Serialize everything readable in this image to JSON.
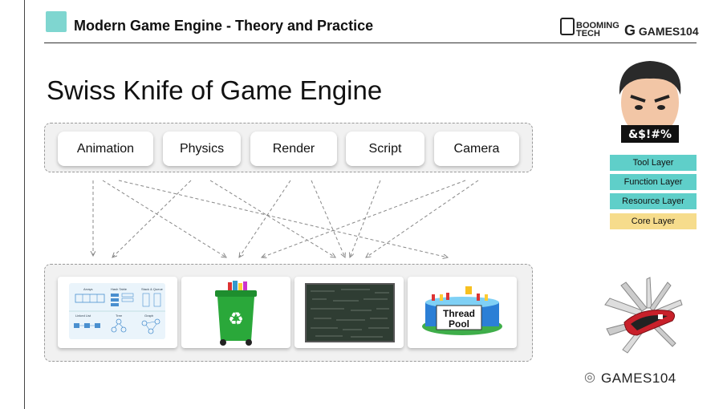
{
  "header": {
    "title": "Modern Game Engine - Theory and Practice",
    "brand_booming": "BOOMING",
    "brand_tech": "TECH",
    "brand_games": "GAMES104"
  },
  "slide_title": "Swiss Knife of Game Engine",
  "modules": [
    "Animation",
    "Physics",
    "Render",
    "Script",
    "Camera"
  ],
  "tiles": {
    "data_structures": {
      "arrays": "Arrays",
      "hash_table": "Hash Table",
      "stack_queue": "Stack & Queue",
      "linked_list": "Linked List",
      "tree": "Tree",
      "graph": "Graph"
    },
    "recycle_bin": {
      "icon": "recycle-bin-icon"
    },
    "math_board": {
      "icon": "chalkboard-icon"
    },
    "thread_pool": {
      "line1": "Thread",
      "line2": "Pool"
    }
  },
  "layers": [
    "Tool Layer",
    "Function Layer",
    "Resource Layer",
    "Core Layer"
  ],
  "avatar": {
    "mouth_text": "&$!#%"
  },
  "footer": {
    "text": "GAMES104",
    "icon": "wechat-icon"
  },
  "colors": {
    "layer_teal": "#5fcfc9",
    "core_yellow": "#f6dc8c",
    "logo_teal": "#7fd6d0"
  }
}
